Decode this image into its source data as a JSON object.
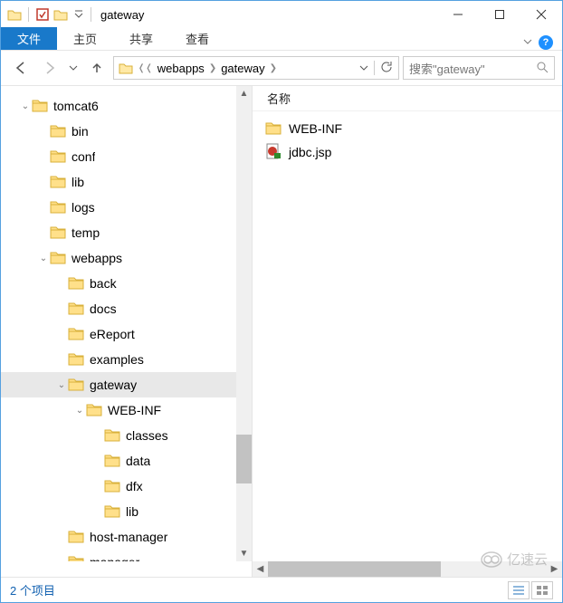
{
  "titlebar": {
    "title": "gateway"
  },
  "ribbon": {
    "file": "文件",
    "tabs": [
      "主页",
      "共享",
      "查看"
    ]
  },
  "nav": {
    "crumbs": [
      "webapps",
      "gateway"
    ],
    "search_placeholder": "搜索\"gateway\""
  },
  "tree": {
    "nodes": [
      {
        "label": "tomcat6",
        "depth": 0,
        "twisty": "down",
        "selected": false
      },
      {
        "label": "bin",
        "depth": 1,
        "twisty": "",
        "selected": false
      },
      {
        "label": "conf",
        "depth": 1,
        "twisty": "",
        "selected": false
      },
      {
        "label": "lib",
        "depth": 1,
        "twisty": "",
        "selected": false
      },
      {
        "label": "logs",
        "depth": 1,
        "twisty": "",
        "selected": false
      },
      {
        "label": "temp",
        "depth": 1,
        "twisty": "",
        "selected": false
      },
      {
        "label": "webapps",
        "depth": 1,
        "twisty": "down",
        "selected": false
      },
      {
        "label": "back",
        "depth": 2,
        "twisty": "",
        "selected": false
      },
      {
        "label": "docs",
        "depth": 2,
        "twisty": "",
        "selected": false
      },
      {
        "label": "eReport",
        "depth": 2,
        "twisty": "",
        "selected": false
      },
      {
        "label": "examples",
        "depth": 2,
        "twisty": "",
        "selected": false
      },
      {
        "label": "gateway",
        "depth": 2,
        "twisty": "down",
        "selected": true
      },
      {
        "label": "WEB-INF",
        "depth": 3,
        "twisty": "down",
        "selected": false
      },
      {
        "label": "classes",
        "depth": 4,
        "twisty": "",
        "selected": false
      },
      {
        "label": "data",
        "depth": 4,
        "twisty": "",
        "selected": false
      },
      {
        "label": "dfx",
        "depth": 4,
        "twisty": "",
        "selected": false
      },
      {
        "label": "lib",
        "depth": 4,
        "twisty": "",
        "selected": false
      },
      {
        "label": "host-manager",
        "depth": 2,
        "twisty": "",
        "selected": false
      },
      {
        "label": "manager",
        "depth": 2,
        "twisty": "",
        "selected": false
      }
    ]
  },
  "content": {
    "column": "名称",
    "items": [
      {
        "name": "WEB-INF",
        "type": "folder"
      },
      {
        "name": "jdbc.jsp",
        "type": "jsp"
      }
    ]
  },
  "status": {
    "text": "2 个项目"
  },
  "watermark": "亿速云"
}
